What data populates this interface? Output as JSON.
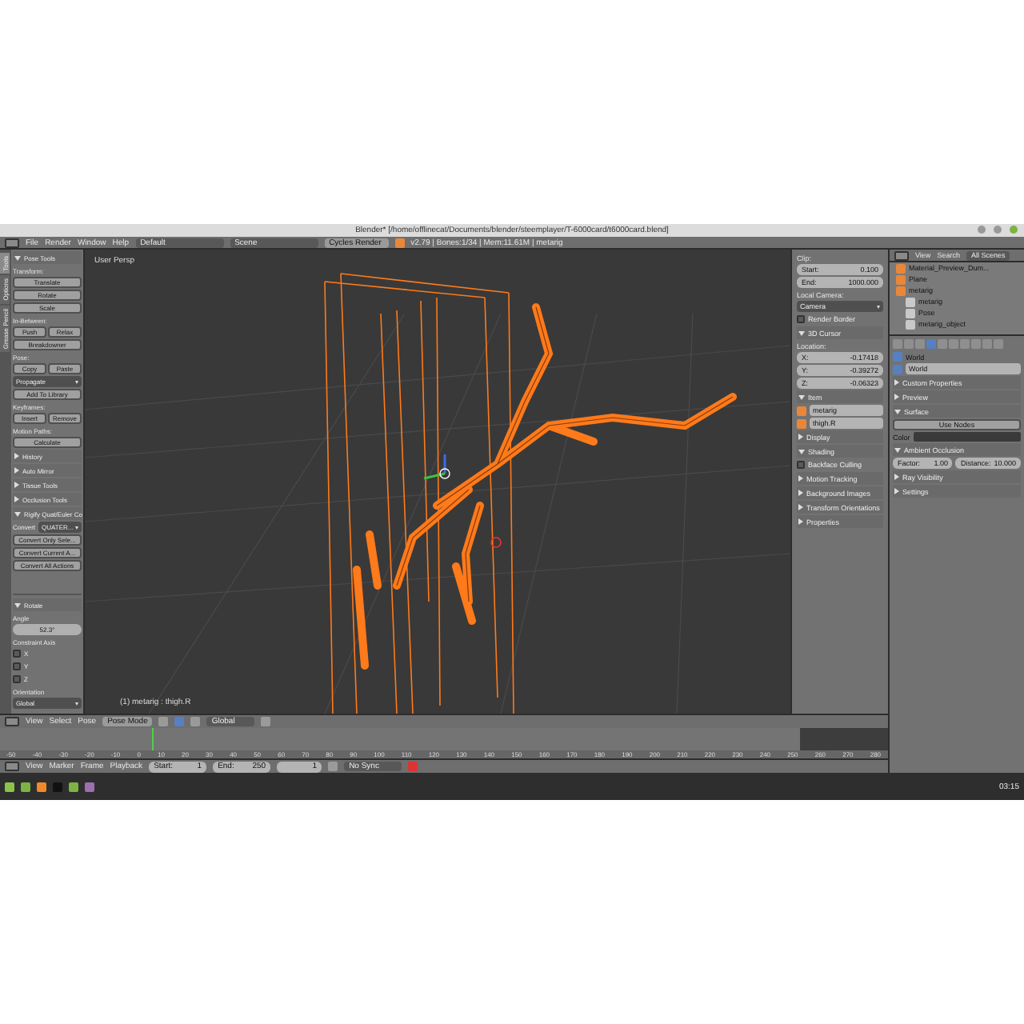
{
  "title_bar": {
    "title": "Blender* [/home/offlinecat/Documents/blender/steemplayer/T-6000card/t6000card.blend]"
  },
  "top_header": {
    "menus": [
      "File",
      "Render",
      "Window",
      "Help"
    ],
    "layout": "Default",
    "scene": "Scene",
    "engine": "Cycles Render",
    "stats": "v2.79 | Bones:1/34 | Mem:11.61M | metarig"
  },
  "tool_shelf": {
    "tabs": [
      {
        "label": "Tools",
        "selected": true
      },
      {
        "label": "Options",
        "selected": false
      },
      {
        "label": "Grease Pencil",
        "selected": false
      }
    ],
    "panels": [
      {
        "title": "Pose Tools",
        "expanded": true,
        "items": [
          {
            "kind": "label",
            "text": "Transform:"
          },
          {
            "kind": "buttons",
            "labels": [
              "Translate"
            ]
          },
          {
            "kind": "buttons",
            "labels": [
              "Rotate"
            ]
          },
          {
            "kind": "buttons",
            "labels": [
              "Scale"
            ]
          },
          {
            "kind": "label",
            "text": "In-Between:"
          },
          {
            "kind": "buttons",
            "labels": [
              "Push",
              "Relax"
            ]
          },
          {
            "kind": "buttons",
            "labels": [
              "Breakdowner"
            ]
          },
          {
            "kind": "label",
            "text": "Pose:"
          },
          {
            "kind": "buttons",
            "labels": [
              "Copy",
              "Paste"
            ]
          },
          {
            "kind": "select",
            "value": "Propagate"
          },
          {
            "kind": "buttons",
            "labels": [
              "Add To Library"
            ]
          },
          {
            "kind": "label",
            "text": "Keyframes:"
          },
          {
            "kind": "buttons",
            "labels": [
              "Insert",
              "Remove"
            ]
          },
          {
            "kind": "label",
            "text": "Motion Paths:"
          },
          {
            "kind": "buttons",
            "labels": [
              "Calculate"
            ]
          }
        ]
      },
      {
        "title": "History",
        "expanded": false
      },
      {
        "title": "Auto Mirror",
        "expanded": false
      },
      {
        "title": "Tissue Tools",
        "expanded": false
      },
      {
        "title": "Occlusion Tools",
        "expanded": false
      },
      {
        "title": "Rigify Quat/Euler Co",
        "expanded": true,
        "items": [
          {
            "kind": "convert",
            "text": "Convert",
            "value": "QUATER..."
          },
          {
            "kind": "buttons",
            "labels": [
              "Convert Only Sele..."
            ]
          },
          {
            "kind": "buttons",
            "labels": [
              "Convert Current A..."
            ]
          },
          {
            "kind": "buttons",
            "labels": [
              "Convert All Actions"
            ]
          }
        ]
      }
    ]
  },
  "operator": {
    "title": "Rotate",
    "expanded": true,
    "angle_label": "Angle",
    "angle": "52.3°",
    "constraint_label": "Constraint Axis",
    "axes": [
      {
        "label": "X",
        "checked": false
      },
      {
        "label": "Y",
        "checked": false
      },
      {
        "label": "Z",
        "checked": false
      }
    ],
    "orientation_label": "Orientation",
    "orientation": "Global"
  },
  "viewport": {
    "view_label": "User Persp",
    "object_label": "(1) metarig : thigh.R"
  },
  "n_panel": {
    "items": [
      {
        "kind": "label",
        "text": "Clip:"
      },
      {
        "kind": "field",
        "label": "Start:",
        "value": "0.100"
      },
      {
        "kind": "field",
        "label": "End:",
        "value": "1000.000"
      },
      {
        "kind": "label",
        "text": "Local Camera:"
      },
      {
        "kind": "dropdown",
        "value": "Camera"
      },
      {
        "kind": "checkbox",
        "label": "Render Border",
        "checked": false
      },
      {
        "kind": "panel",
        "label": "3D Cursor",
        "expanded": true
      },
      {
        "kind": "label",
        "text": "Location:"
      },
      {
        "kind": "field",
        "label": "X:",
        "value": "-0.17418"
      },
      {
        "kind": "field",
        "label": "Y:",
        "value": "-0.39272"
      },
      {
        "kind": "field",
        "label": "Z:",
        "value": "-0.06323"
      },
      {
        "kind": "panel",
        "label": "Item",
        "expanded": true
      },
      {
        "kind": "name",
        "value": "metarig"
      },
      {
        "kind": "name",
        "value": "thigh.R"
      },
      {
        "kind": "panel",
        "label": "Display",
        "expanded": false
      },
      {
        "kind": "panel",
        "label": "Shading",
        "expanded": true
      },
      {
        "kind": "checkbox",
        "label": "Backface Culling",
        "checked": false
      },
      {
        "kind": "panel",
        "label": "Motion Tracking",
        "expanded": false
      },
      {
        "kind": "panel",
        "label": "Background Images",
        "expanded": false
      },
      {
        "kind": "panel",
        "label": "Transform Orientations",
        "expanded": false
      },
      {
        "kind": "panel",
        "label": "Properties",
        "expanded": false
      }
    ]
  },
  "outliner": {
    "menus": [
      "View",
      "Search"
    ],
    "filter": "All Scenes",
    "tree": [
      {
        "label": "Material_Preview_Dum..."
      },
      {
        "label": "Plane"
      },
      {
        "label": "metarig",
        "children": [
          {
            "label": "metarig"
          },
          {
            "label": "Pose"
          },
          {
            "label": "metarig_object"
          }
        ]
      }
    ]
  },
  "properties": {
    "tabs": [
      {
        "selected": false
      },
      {
        "selected": false
      },
      {
        "selected": false
      },
      {
        "selected": true
      },
      {
        "selected": false
      },
      {
        "selected": false
      },
      {
        "selected": false
      },
      {
        "selected": false
      },
      {
        "selected": false
      },
      {
        "selected": false
      }
    ],
    "context": "World",
    "world": "World",
    "items": [
      {
        "kind": "panel",
        "label": "Custom Properties",
        "expanded": false
      },
      {
        "kind": "panel",
        "label": "Preview",
        "expanded": false
      },
      {
        "kind": "panel",
        "label": "Surface",
        "expanded": true
      },
      {
        "kind": "button",
        "label": "Use Nodes"
      },
      {
        "kind": "color",
        "label": "Color"
      },
      {
        "kind": "panel",
        "label": "Ambient Occlusion",
        "expanded": true
      },
      {
        "kind": "pair",
        "label": "Factor:",
        "value": "1.00",
        "label2": "Distance:",
        "value2": "10.000"
      },
      {
        "kind": "panel",
        "label": "Ray Visibility",
        "expanded": false
      },
      {
        "kind": "panel",
        "label": "Settings",
        "expanded": false
      }
    ]
  },
  "viewport_header": {
    "menus": [
      "View",
      "Select",
      "Pose"
    ],
    "mode": "Pose Mode",
    "orientation": "Global"
  },
  "timeline": {
    "ticks": [
      "-50",
      "-40",
      "-30",
      "-20",
      "-10",
      "0",
      "10",
      "20",
      "30",
      "40",
      "50",
      "60",
      "70",
      "80",
      "90",
      "100",
      "110",
      "120",
      "130",
      "140",
      "150",
      "160",
      "170",
      "180",
      "190",
      "200",
      "210",
      "220",
      "230",
      "240",
      "250",
      "260",
      "270",
      "280"
    ]
  },
  "timeline_header": {
    "menus": [
      "View",
      "Marker",
      "Frame",
      "Playback"
    ],
    "start_label": "Start:",
    "start": "1",
    "end_label": "End:",
    "end": "250",
    "current": "1",
    "sync": "No Sync"
  },
  "taskbar": {
    "clock": "03:15"
  }
}
